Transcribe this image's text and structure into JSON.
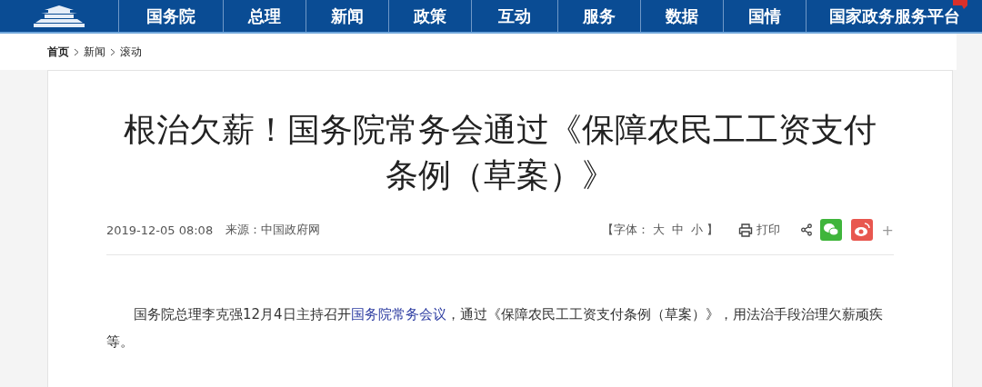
{
  "nav": {
    "items": [
      {
        "label": "国务院"
      },
      {
        "label": "总理"
      },
      {
        "label": "新闻"
      },
      {
        "label": "政策"
      },
      {
        "label": "互动"
      },
      {
        "label": "服务"
      },
      {
        "label": "数据"
      },
      {
        "label": "国情"
      },
      {
        "label": "国家政务服务平台"
      }
    ]
  },
  "breadcrumb": [
    "首页",
    "新闻",
    "滚动"
  ],
  "article": {
    "title": "根治欠薪！国务院常务会通过《保障农民工工资支付条例（草案）》",
    "date": "2019-12-05 08:08",
    "source_label": "来源：",
    "source": "中国政府网",
    "font_size": {
      "open": "【字体：",
      "sizes": [
        "大",
        "中",
        "小"
      ],
      "close": "】"
    },
    "print": "打印",
    "more": "+",
    "paragraph": {
      "before": "国务院总理李克强12月4日主持召开",
      "link": "国务院常务会议",
      "after": "，通过《保障农民工工资支付条例（草案）》，用法治手段治理欠薪顽疾等。"
    }
  }
}
